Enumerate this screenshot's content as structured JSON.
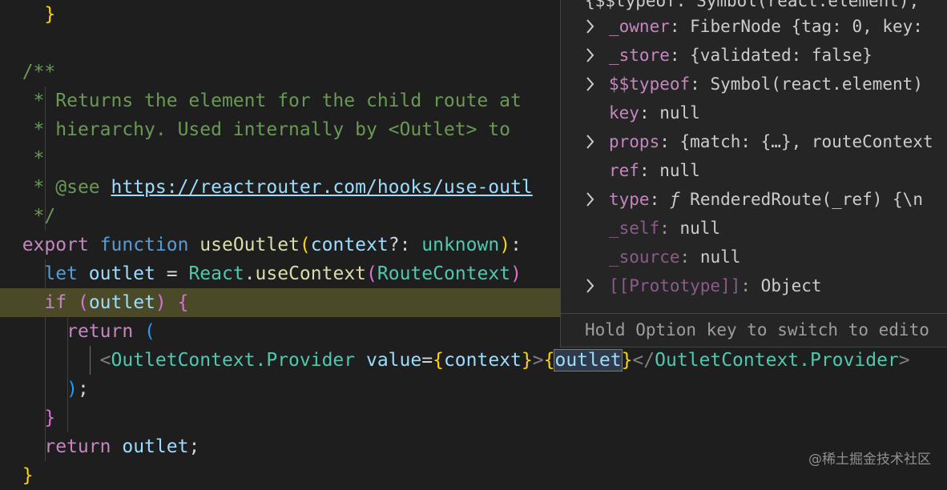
{
  "code": {
    "l0_close": "}",
    "doc_open": "/**",
    "doc_line1": " * Returns the element for the child route at",
    "doc_line2": " * hierarchy. Used internally by <Outlet> to",
    "doc_line3": " *",
    "doc_see_prefix": " * @see ",
    "doc_see_link": "https://reactrouter.com/hooks/use-outl",
    "doc_close": " */",
    "fn_export": "export",
    "fn_function": "function",
    "fn_name": "useOutlet",
    "fn_paren_open": "(",
    "fn_param": "context",
    "fn_param_rest": "?: ",
    "fn_param_type": "unknown",
    "fn_paren_close": ")",
    "fn_colon": ":",
    "let_kw": "let",
    "let_var": "outlet",
    "let_eq": " = ",
    "let_obj": "React",
    "let_dot": ".",
    "let_method": "useContext",
    "let_paren": "(",
    "let_arg": "RouteContext",
    "let_paren_close": ")",
    "if_kw": "if",
    "if_paren": "(",
    "if_var": "outlet",
    "if_paren_close": ")",
    "if_brace": "{",
    "return_kw": "return",
    "return_paren": "(",
    "jsx_open_lt": "<",
    "jsx_tag": "OutletContext.Provider",
    "jsx_attr": "value",
    "jsx_eq": "=",
    "jsx_brace1": "{",
    "jsx_ctx": "context",
    "jsx_brace1c": "}",
    "jsx_gt": ">",
    "jsx_brace2": "{",
    "jsx_outlet": "outlet",
    "jsx_brace2c": "}",
    "jsx_close_lt": "</",
    "jsx_close_tag": "OutletContext.Provider",
    "jsx_close_gt": ">",
    "return_close": ")",
    "return_semi": ";",
    "if_close": "}",
    "return2_kw": "return",
    "return2_var": "outlet",
    "return2_semi": ";",
    "fn_close": "}"
  },
  "hover": {
    "top_partial": "{$$typeof: Symbol(react.element),",
    "rows": [
      {
        "key": "_owner",
        "value": "FiberNode {tag: 0, key:",
        "expandable": true
      },
      {
        "key": "_store",
        "value": "{validated: false}",
        "expandable": true
      },
      {
        "key": "$$typeof",
        "value": "Symbol(react.element)",
        "expandable": true
      },
      {
        "key": "key",
        "value": "null",
        "expandable": false
      },
      {
        "key": "props",
        "value": "{match: {…}, routeContext",
        "expandable": true
      },
      {
        "key": "ref",
        "value": "null",
        "expandable": false
      },
      {
        "key": "type",
        "value_prefix": "ƒ",
        "value": "RenderedRoute(_ref) {\\n",
        "expandable": true
      },
      {
        "key": "_self",
        "value": "null",
        "expandable": false,
        "dim": true
      },
      {
        "key": "_source",
        "value": "null",
        "expandable": false,
        "dim": true
      },
      {
        "key": "[[Prototype]]",
        "value": "Object",
        "expandable": true,
        "dim": true
      }
    ],
    "hint": "Hold Option key to switch to edito"
  },
  "icons": {
    "expand": "chevron-right-icon"
  },
  "watermark": "@稀土掘金技术社区",
  "colors": {
    "editor_bg": "#1e1e1e",
    "highlight_line": "#4a4a28",
    "popup_bg": "#252526",
    "comment": "#6a9955",
    "keyword": "#569cd6",
    "control": "#c586c0"
  }
}
